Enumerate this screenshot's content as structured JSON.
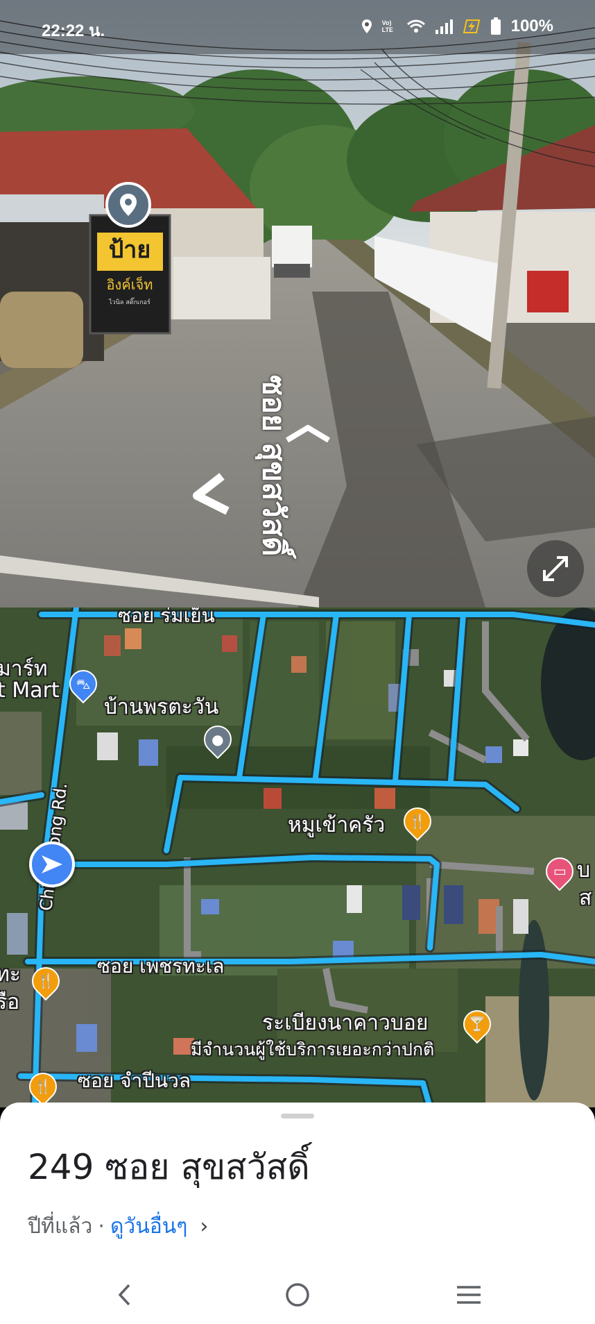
{
  "status_bar": {
    "time": "22:22 น.",
    "battery_percent": "100%",
    "network_label": "Vo) LTE",
    "icons": [
      "location-icon",
      "volte-icon",
      "wifi-icon",
      "signal-icon",
      "charging-icon",
      "battery-icon"
    ]
  },
  "street_view": {
    "road_marking": "ซอย สุขสวัสดิ์",
    "shop_sign_main": "ป้าย",
    "shop_sign_sub": "อิงค์เจ็ท",
    "shop_sign_top": "ไวนิล สติ๊กเกอร์",
    "expand_icon": "expand-icon",
    "chevrons": [
      "chevron-forward-icon",
      "chevron-left-icon"
    ]
  },
  "map": {
    "labels": {
      "road_top": "ซอย ร่มเย็น",
      "mart_line1": "มาร์ท",
      "mart_line2": "t Mart",
      "house": "บ้านพรตะวัน",
      "road_vertical": "Chiangrong Rd.",
      "restaurant": "หมูเข้าครัว",
      "lodging_edge": "บ",
      "lodging_edge2": "ส",
      "left_edge1": "ทะ",
      "left_edge2": "รือ",
      "road_mid": "ซอย เพชรทะเล",
      "bar_name": "ระเบียงนาคาวบอย",
      "bar_note": "มีจำนวนผู้ใช้บริการเยอะกว่าปกติ",
      "road_bottom": "ซอย จำปีนวล"
    },
    "colors": {
      "road_highlight": "#29b6f6",
      "poi_food": "#f29d0c",
      "poi_shop": "#4285f4",
      "poi_lodging": "#e8537a",
      "poi_place": "#6b7a88"
    }
  },
  "sheet": {
    "title": "249 ซอย สุขสวัสดิ์",
    "date_text": "ปีที่แล้ว",
    "separator": "·",
    "see_more": "ดูวันอื่นๆ",
    "chevron": "›"
  },
  "nav_bar": {
    "buttons": [
      "back-icon",
      "home-icon",
      "recents-icon"
    ]
  }
}
